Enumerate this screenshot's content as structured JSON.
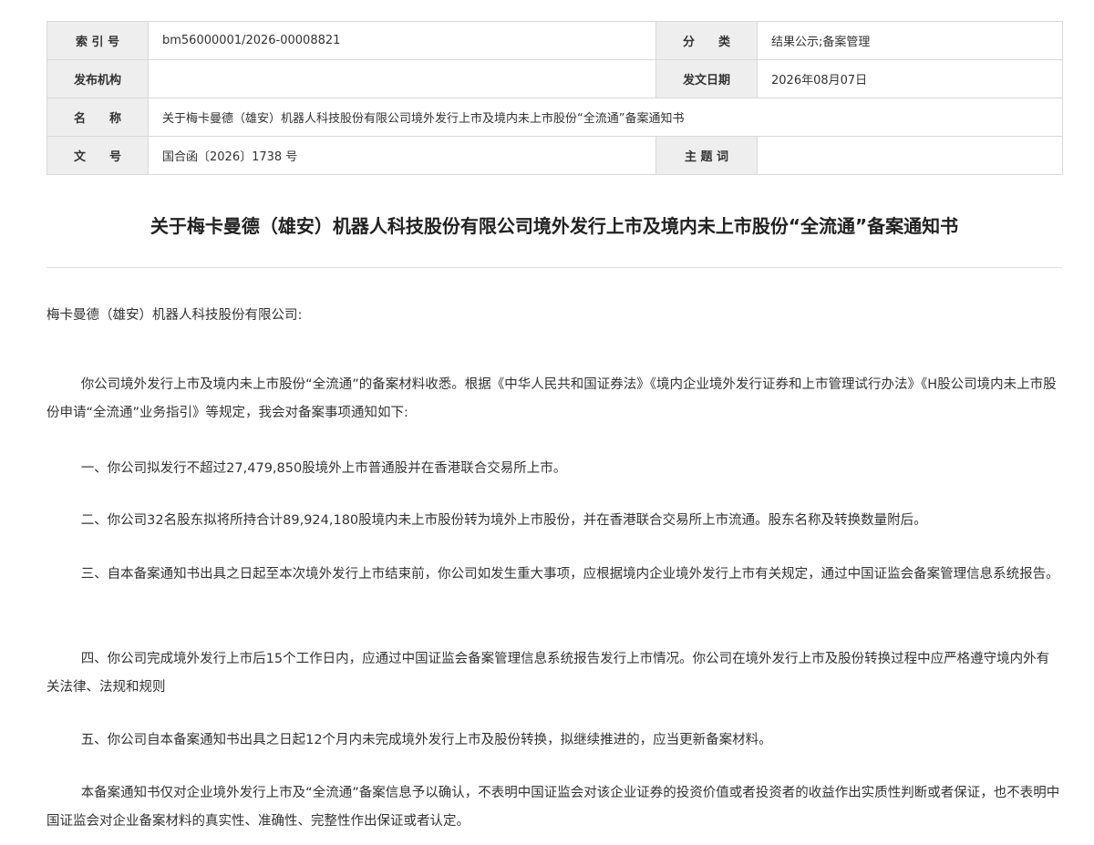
{
  "meta": {
    "index_label": "索 引 号",
    "index_value": "bm56000001/2026-00008821",
    "category_label": "分　　类",
    "category_value": "结果公示;备案管理",
    "issuer_label": "发布机构",
    "issuer_value": "",
    "date_label": "发文日期",
    "date_value": "2026年08月07日",
    "name_label": "名　　称",
    "name_value": "关于梅卡曼德（雄安）机器人科技股份有限公司境外发行上市及境内未上市股份“全流通”备案通知书",
    "docno_label": "文　　号",
    "docno_value": "国合函〔2026〕1738 号",
    "subject_label": "主 题 词",
    "subject_value": ""
  },
  "document": {
    "title": "关于梅卡曼德（雄安）机器人科技股份有限公司境外发行上市及境内未上市股份“全流通”备案通知书",
    "addressee": "梅卡曼德（雄安）机器人科技股份有限公司:",
    "paragraphs": [
      "你公司境外发行上市及境内未上市股份“全流通”的备案材料收悉。根据《中华人民共和国证券法》《境内企业境外发行证券和上市管理试行办法》《H股公司境内未上市股份申请“全流通”业务指引》等规定，我会对备案事项通知如下:",
      "一、你公司拟发行不超过27,479,850股境外上市普通股并在香港联合交易所上市。",
      "二、你公司32名股东拟将所持合计89,924,180股境内未上市股份转为境外上市股份，并在香港联合交易所上市流通。股东名称及转换数量附后。",
      "三、自本备案通知书出具之日起至本次境外发行上市结束前，你公司如发生重大事项，应根据境内企业境外发行上市有关规定，通过中国证监会备案管理信息系统报告。",
      "四、你公司完成境外发行上市后15个工作日内，应通过中国证监会备案管理信息系统报告发行上市情况。你公司在境外发行上市及股份转换过程中应严格遵守境内外有关法律、法规和规则",
      "五、你公司自本备案通知书出具之日起12个月内未完成境外发行上市及股份转换，拟继续推进的，应当更新备案材料。",
      "本备案通知书仅对企业境外发行上市及“全流通”备案信息予以确认，不表明中国证监会对该企业证券的投资价值或者投资者的收益作出实质性判断或者保证，也不表明中国证监会对企业备案材料的真实性、准确性、完整性作出保证或者认定。"
    ]
  }
}
